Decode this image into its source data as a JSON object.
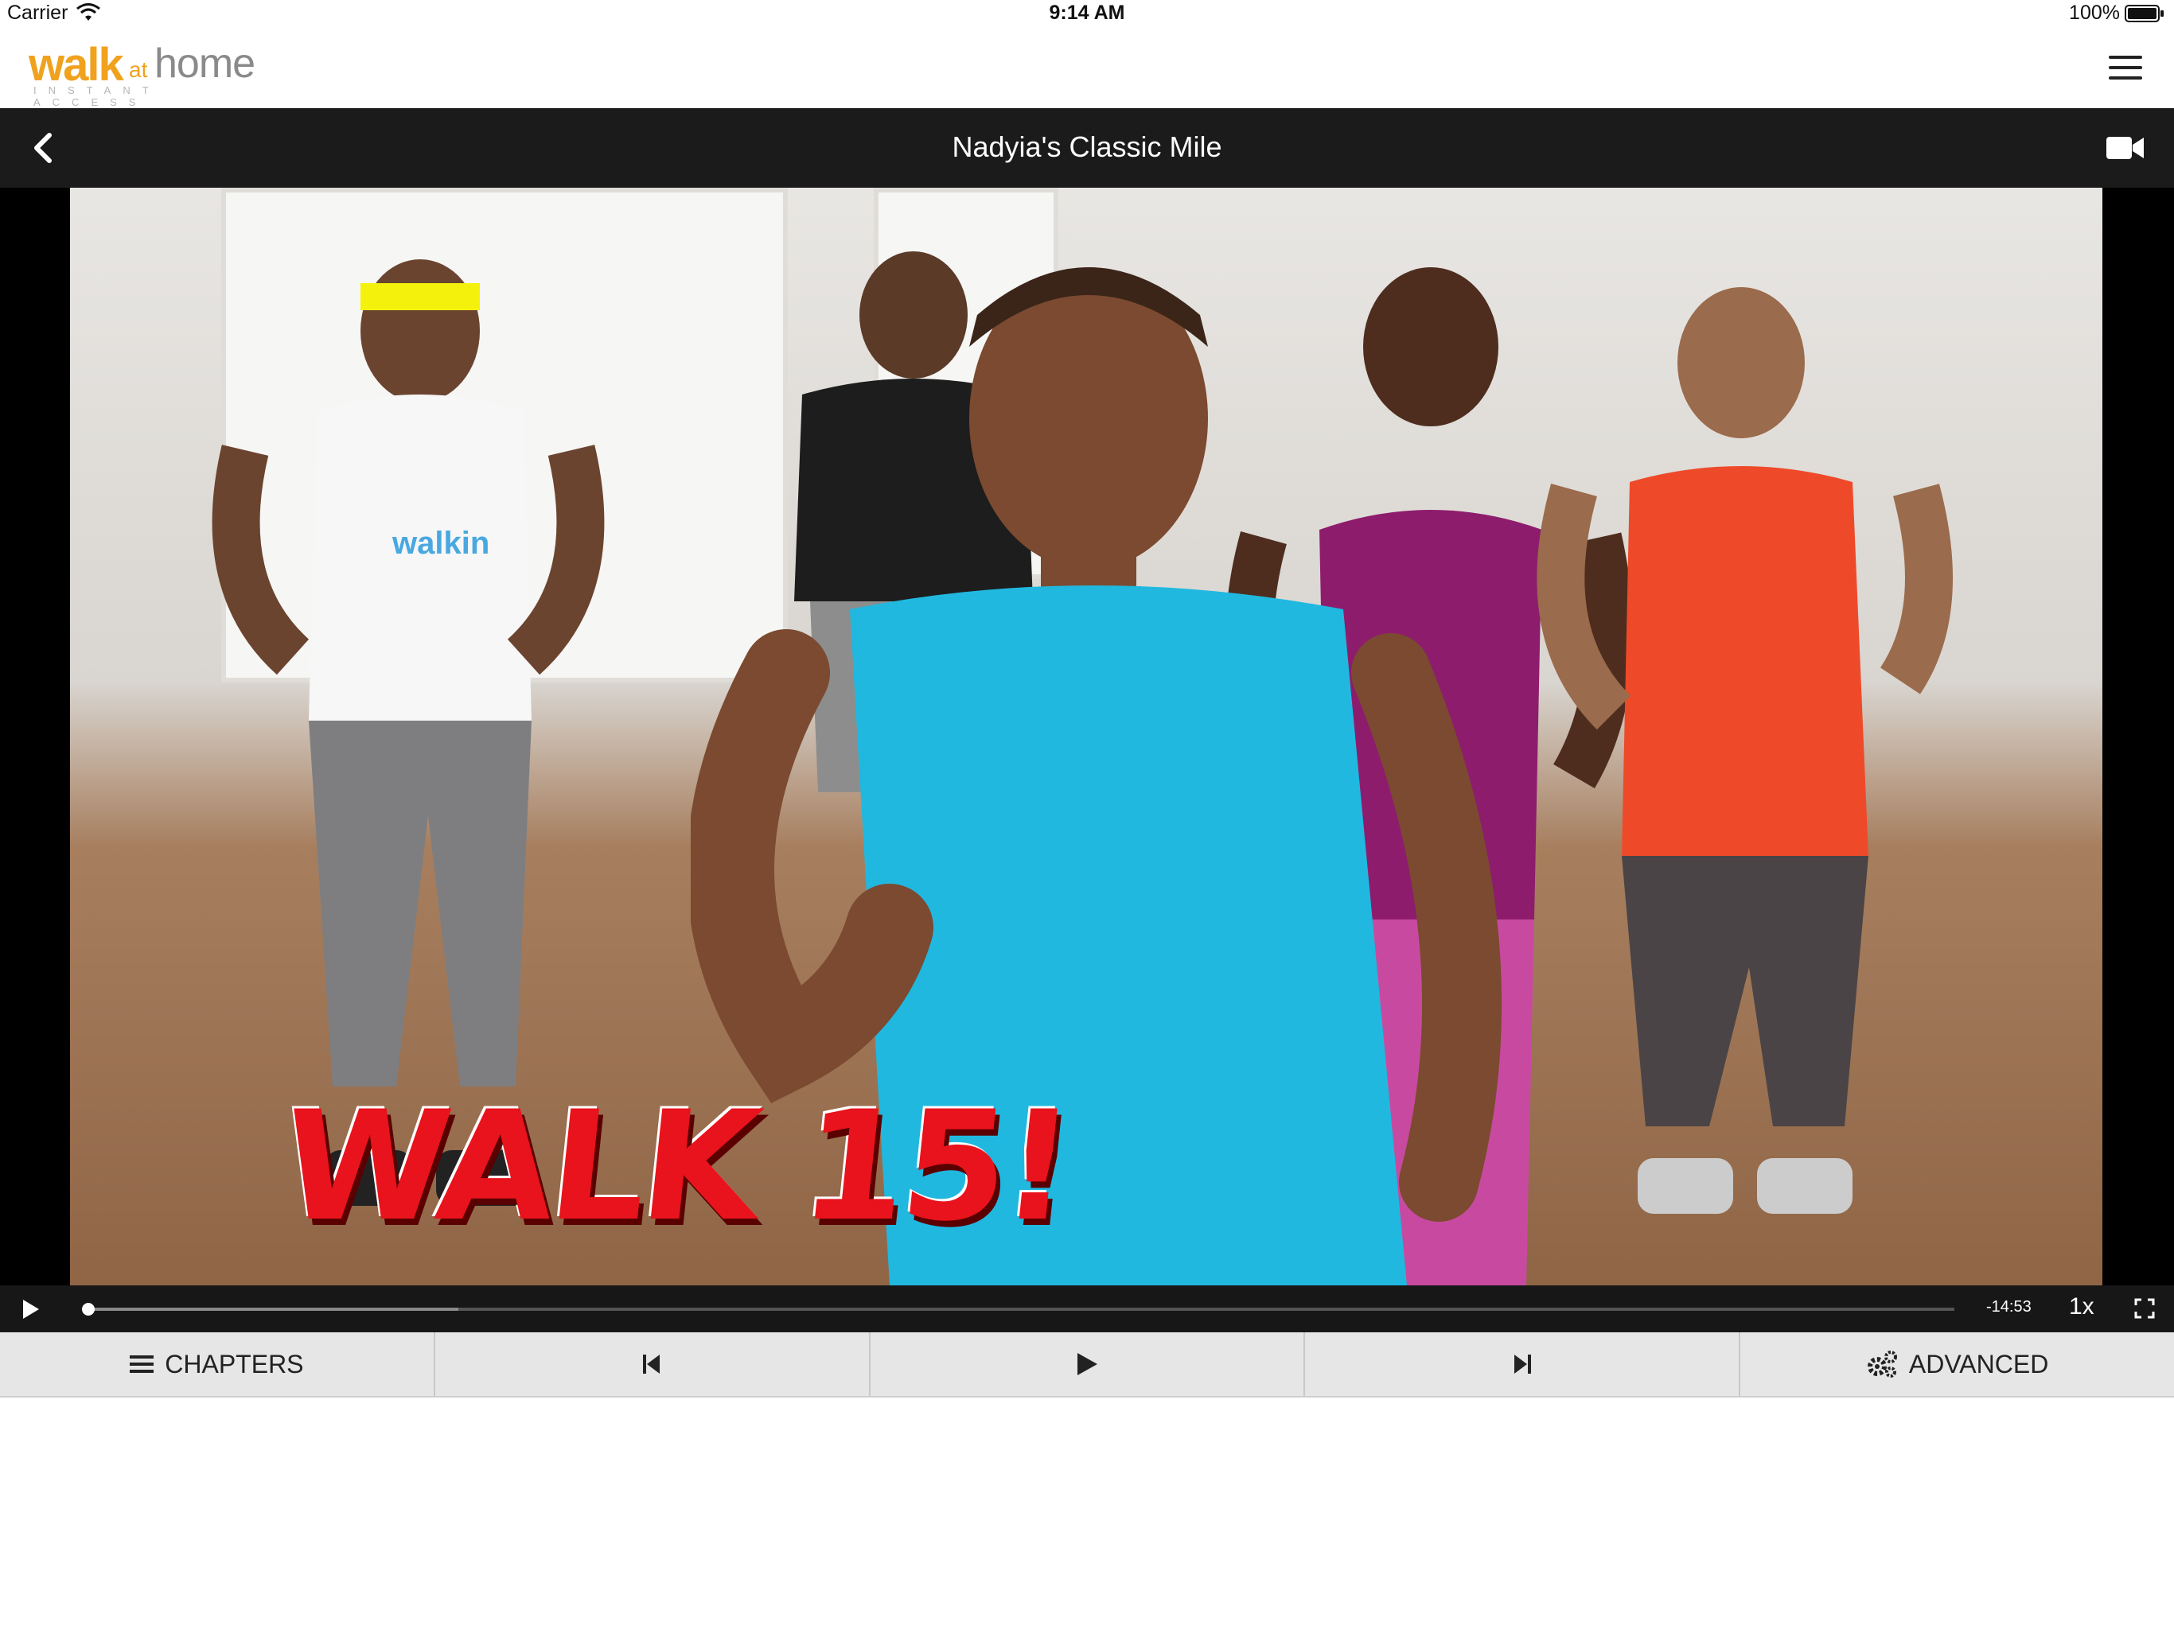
{
  "status_bar": {
    "carrier": "Carrier",
    "time": "9:14 AM",
    "battery": "100%"
  },
  "header": {
    "logo_walk": "walk",
    "logo_at": "at",
    "logo_home": "home",
    "logo_sub": "INSTANT ACCESS"
  },
  "titlebar": {
    "title": "Nadyia's Classic Mile"
  },
  "video": {
    "overlay_caption": "WALK 15!",
    "shirt_text": "walkin",
    "time_remaining": "-14:53",
    "speed": "1x",
    "progress": 0.002,
    "buffered": 0.2
  },
  "toolbar": {
    "chapters_label": "CHAPTERS",
    "advanced_label": "ADVANCED"
  },
  "icons": {
    "back": "chevron-left-icon",
    "menu": "hamburger-menu-icon",
    "video": "video-camera-icon",
    "play": "play-icon",
    "prev": "skip-previous-icon",
    "next": "skip-next-icon",
    "fullscreen": "fullscreen-icon",
    "settings": "gears-icon",
    "list": "list-icon"
  },
  "colors": {
    "brand_orange": "#f0a21e",
    "titlebar": "#1b1b1b",
    "caption_red": "#e8131c"
  }
}
